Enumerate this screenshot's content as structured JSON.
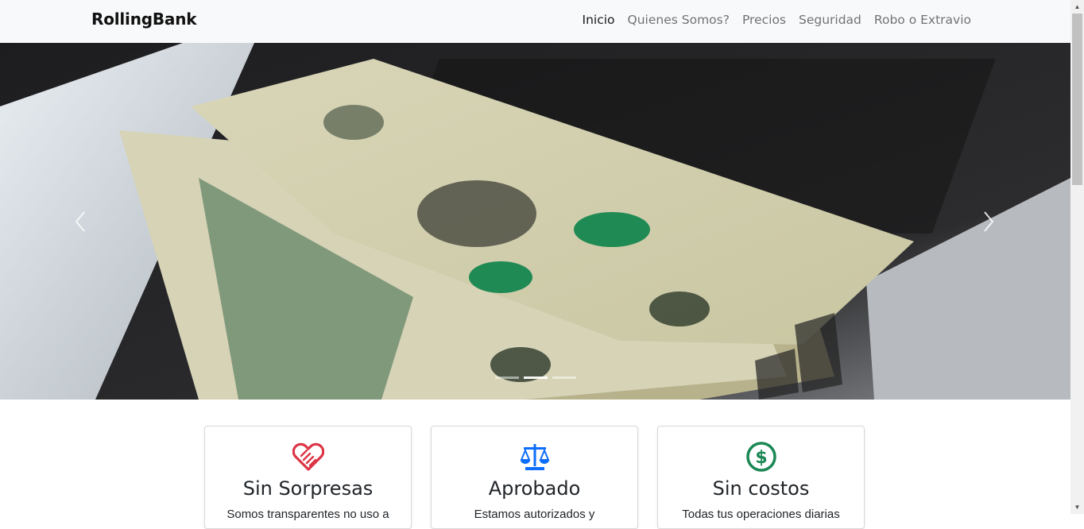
{
  "brand": "RollingBank",
  "nav": {
    "items": [
      {
        "label": "Inicio",
        "active": true
      },
      {
        "label": "Quienes Somos?",
        "active": false
      },
      {
        "label": "Precios",
        "active": false
      },
      {
        "label": "Seguridad",
        "active": false
      },
      {
        "label": "Robo o Extravio",
        "active": false
      }
    ]
  },
  "carousel": {
    "prev_icon": "chevron-left-icon",
    "next_icon": "chevron-right-icon",
    "indicators": 3,
    "active_index": 1
  },
  "features": [
    {
      "icon": "handshake-icon",
      "color": "#dc3545",
      "title": "Sin Sorpresas",
      "text": "Somos transparentes no uso a"
    },
    {
      "icon": "scales-icon",
      "color": "#0d6efd",
      "title": "Aprobado",
      "text": "Estamos autorizados y"
    },
    {
      "icon": "dollar-circle-icon",
      "color": "#198754",
      "title": "Sin costos",
      "text": "Todas tus operaciones diarias"
    }
  ]
}
